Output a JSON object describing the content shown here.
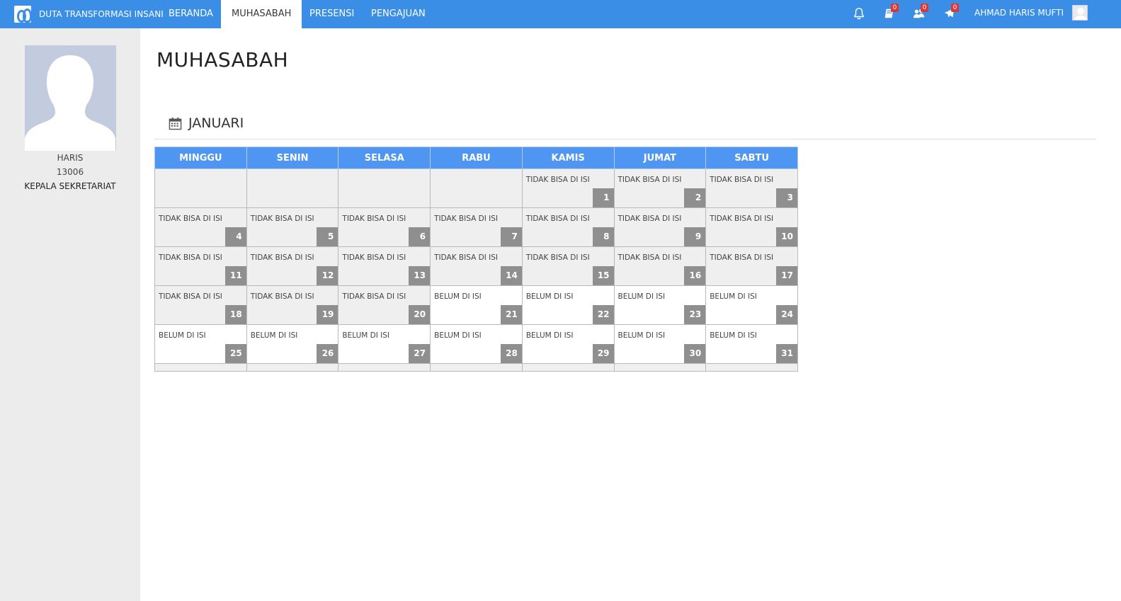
{
  "navbar": {
    "brand": "DUTA TRANSFORMASI INSANI",
    "tabs": [
      {
        "label": "BERANDA"
      },
      {
        "label": "MUHASABAH"
      },
      {
        "label": "PRESENSI"
      },
      {
        "label": "PENGAJUAN"
      }
    ],
    "active_tab": "MUHASABAH",
    "icons": [
      {
        "name": "bell-icon"
      },
      {
        "name": "book-icon",
        "badge": "0"
      },
      {
        "name": "users-icon",
        "badge": "0"
      },
      {
        "name": "plane-icon",
        "badge": "0"
      }
    ],
    "user_name": "AHMAD HARIS MUFTI"
  },
  "sidebar": {
    "name": "HARIS",
    "id": "13006",
    "position": "KEPALA SEKRETARIAT"
  },
  "page": {
    "title": "MUHASABAH",
    "month": "JANUARI"
  },
  "calendar": {
    "headers": [
      "MINGGU",
      "SENIN",
      "SELASA",
      "RABU",
      "KAMIS",
      "JUMAT",
      "SABTU"
    ],
    "weeks": [
      [
        {
          "day": "",
          "status": ""
        },
        {
          "day": "",
          "status": ""
        },
        {
          "day": "",
          "status": ""
        },
        {
          "day": "",
          "status": ""
        },
        {
          "day": "1",
          "status": "TIDAK BISA DI ISI"
        },
        {
          "day": "2",
          "status": "TIDAK BISA DI ISI"
        },
        {
          "day": "3",
          "status": "TIDAK BISA DI ISI"
        }
      ],
      [
        {
          "day": "4",
          "status": "TIDAK BISA DI ISI"
        },
        {
          "day": "5",
          "status": "TIDAK BISA DI ISI"
        },
        {
          "day": "6",
          "status": "TIDAK BISA DI ISI"
        },
        {
          "day": "7",
          "status": "TIDAK BISA DI ISI"
        },
        {
          "day": "8",
          "status": "TIDAK BISA DI ISI"
        },
        {
          "day": "9",
          "status": "TIDAK BISA DI ISI"
        },
        {
          "day": "10",
          "status": "TIDAK BISA DI ISI"
        }
      ],
      [
        {
          "day": "11",
          "status": "TIDAK BISA DI ISI"
        },
        {
          "day": "12",
          "status": "TIDAK BISA DI ISI"
        },
        {
          "day": "13",
          "status": "TIDAK BISA DI ISI"
        },
        {
          "day": "14",
          "status": "TIDAK BISA DI ISI"
        },
        {
          "day": "15",
          "status": "TIDAK BISA DI ISI"
        },
        {
          "day": "16",
          "status": "TIDAK BISA DI ISI"
        },
        {
          "day": "17",
          "status": "TIDAK BISA DI ISI"
        }
      ],
      [
        {
          "day": "18",
          "status": "TIDAK BISA DI ISI"
        },
        {
          "day": "19",
          "status": "TIDAK BISA DI ISI"
        },
        {
          "day": "20",
          "status": "TIDAK BISA DI ISI"
        },
        {
          "day": "21",
          "status": "BELUM DI ISI"
        },
        {
          "day": "22",
          "status": "BELUM DI ISI"
        },
        {
          "day": "23",
          "status": "BELUM DI ISI"
        },
        {
          "day": "24",
          "status": "BELUM DI ISI"
        }
      ],
      [
        {
          "day": "25",
          "status": "BELUM DI ISI"
        },
        {
          "day": "26",
          "status": "BELUM DI ISI"
        },
        {
          "day": "27",
          "status": "BELUM DI ISI"
        },
        {
          "day": "28",
          "status": "BELUM DI ISI"
        },
        {
          "day": "29",
          "status": "BELUM DI ISI"
        },
        {
          "day": "30",
          "status": "BELUM DI ISI"
        },
        {
          "day": "31",
          "status": "BELUM DI ISI"
        }
      ]
    ]
  },
  "colors": {
    "navbar": "#3a8ee6",
    "calendar_header": "#4f95f2",
    "badge": "#e03535",
    "day_box": "#8f8f8f",
    "disabled_cell": "#efefef",
    "open_cell": "#ffffff",
    "sidebar": "#ececec"
  }
}
